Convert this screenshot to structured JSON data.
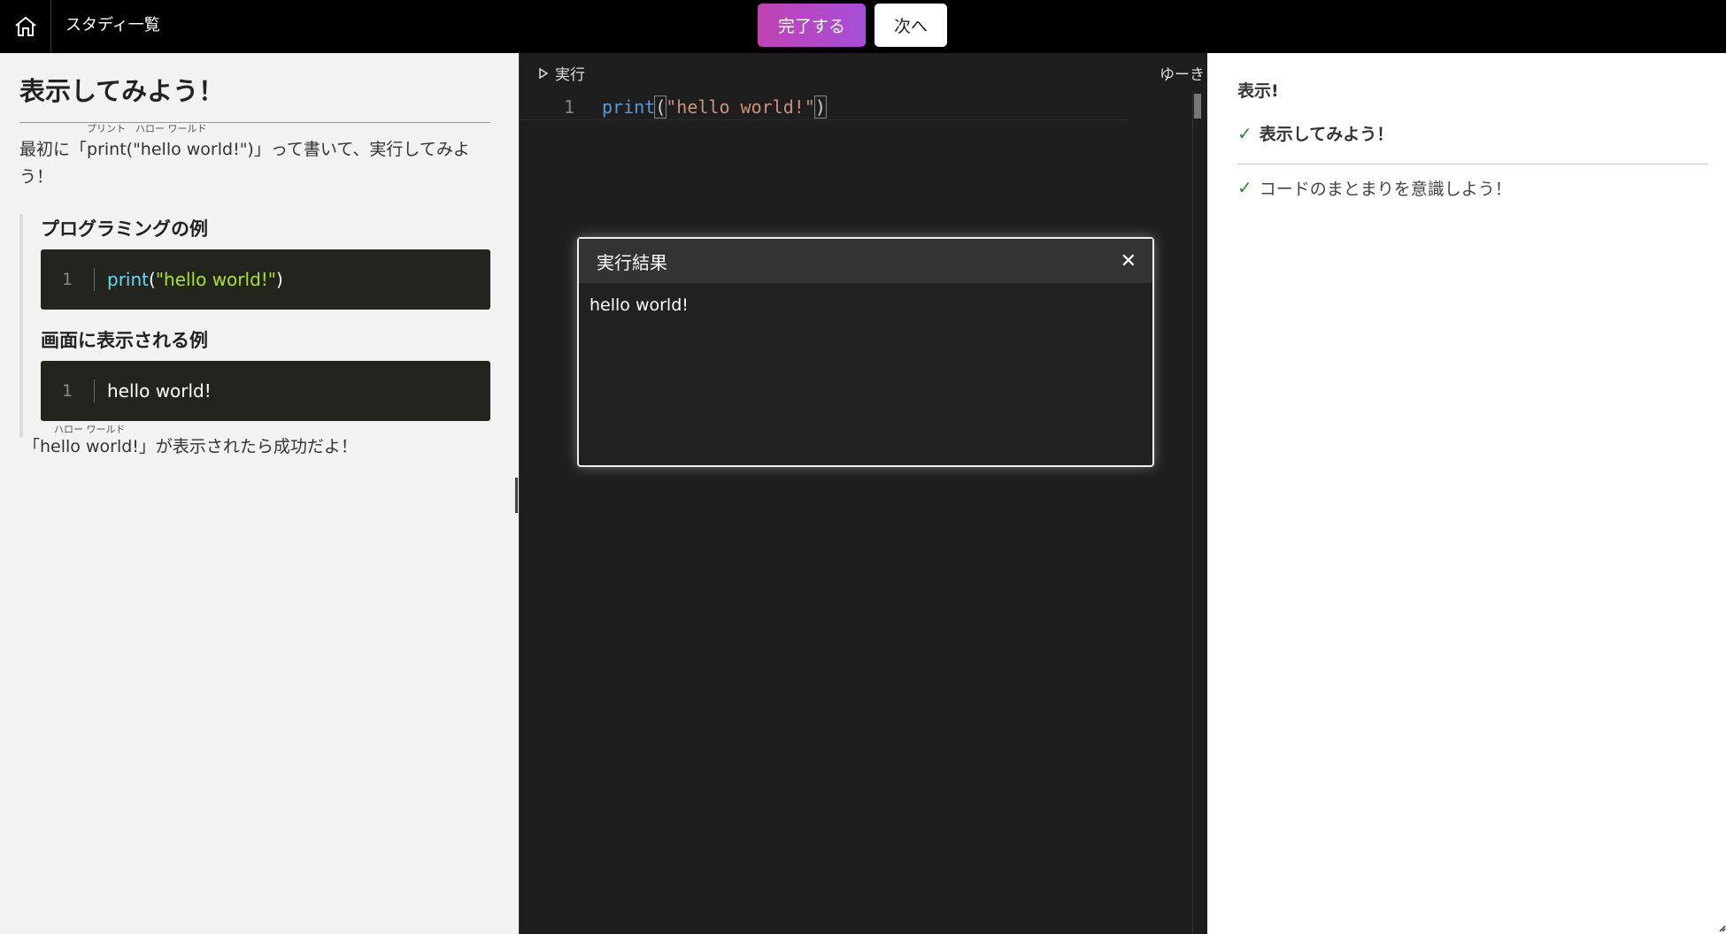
{
  "topbar": {
    "studies_label": "スタディ一覧",
    "complete_label": "完了する",
    "next_label": "次へ"
  },
  "lesson": {
    "title": "表示してみよう！",
    "instruction_prefix": "最初に「",
    "instruction_code": "print(\"hello world!\")",
    "instruction_code_ruby": "プリント　ハロー ワールド",
    "instruction_suffix": "」って書いて、実行してみよう！",
    "example_heading": "プログラミングの例",
    "example_line_no": "1",
    "example_fn": "print",
    "example_open": "(",
    "example_str": "\"hello world!\"",
    "example_close": ")",
    "output_heading": "画面に表示される例",
    "output_line_no": "1",
    "output_text": "hello world!",
    "success_prefix": "「",
    "success_word": "hello world!",
    "success_ruby": "ハロー ワールド",
    "success_suffix": "」が表示されたら成功だよ！"
  },
  "editor": {
    "run_label": "実行",
    "user_name": "ゆーき",
    "line_no": "1",
    "code_fn": "print",
    "code_open": "(",
    "code_str": "\"hello world!\"",
    "code_close": ")"
  },
  "result": {
    "title": "実行結果",
    "output": "hello world!"
  },
  "sidebar": {
    "chapter": "表示!",
    "items": [
      {
        "label": "表示してみよう！"
      },
      {
        "label": "コードのまとまりを意識しよう！"
      }
    ]
  },
  "colors": {
    "accent_gradient_start": "#c042b2",
    "accent_gradient_end": "#a64fd9",
    "check": "#2c8a3a"
  }
}
